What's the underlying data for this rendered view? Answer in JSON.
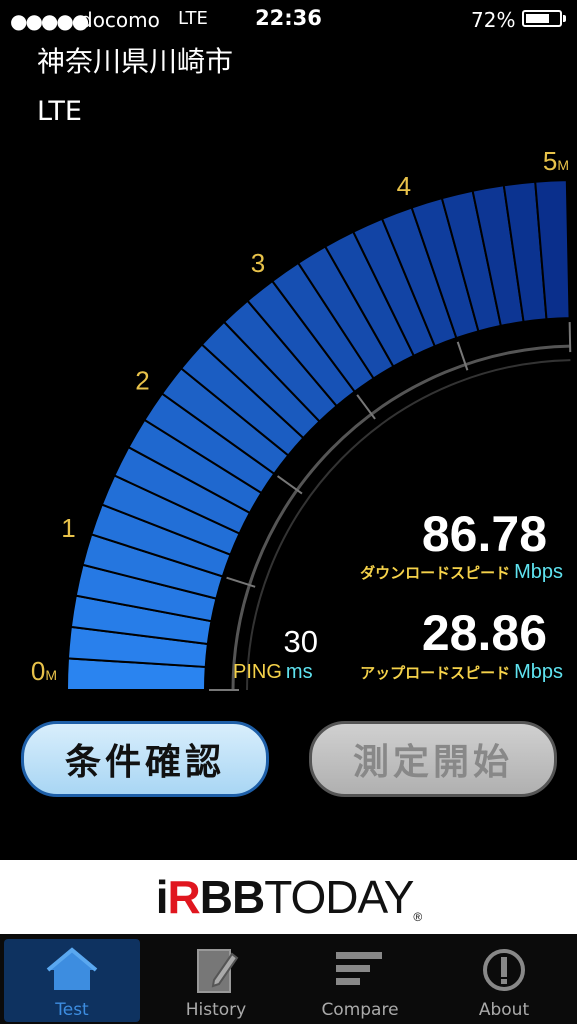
{
  "status_bar": {
    "signal": "●●●●●",
    "carrier": "docomo",
    "network": "LTE",
    "time": "22:36",
    "battery_percent": "72%",
    "battery_level": 0.72
  },
  "location": "神奈川県川崎市",
  "network_type": "LTE",
  "gauge": {
    "tick_labels": [
      "0",
      "1",
      "2",
      "3",
      "4",
      "5"
    ],
    "unit_mark": "M",
    "colors": {
      "bar_light": "#2a84f0",
      "bar_dark": "#0a2f8c",
      "tick_label": "#e8c24a"
    }
  },
  "results": {
    "download_value": "86.78",
    "download_label": "ダウンロードスピード",
    "download_unit": "Mbps",
    "upload_value": "28.86",
    "upload_label": "アップロードスピード",
    "upload_unit": "Mbps",
    "ping_value": "30",
    "ping_label": "PING",
    "ping_unit": "ms"
  },
  "buttons": {
    "conditions": "条件確認",
    "start": "測定開始"
  },
  "banner": {
    "logo_i": "i",
    "logo_r": "R",
    "logo_bb": "BB",
    "logo_today": "TODAY",
    "logo_reg": "®"
  },
  "tabs": [
    {
      "label": "Test",
      "icon": "home-icon",
      "active": true
    },
    {
      "label": "History",
      "icon": "notepad-icon",
      "active": false
    },
    {
      "label": "Compare",
      "icon": "bars-icon",
      "active": false
    },
    {
      "label": "About",
      "icon": "info-icon",
      "active": false
    }
  ]
}
